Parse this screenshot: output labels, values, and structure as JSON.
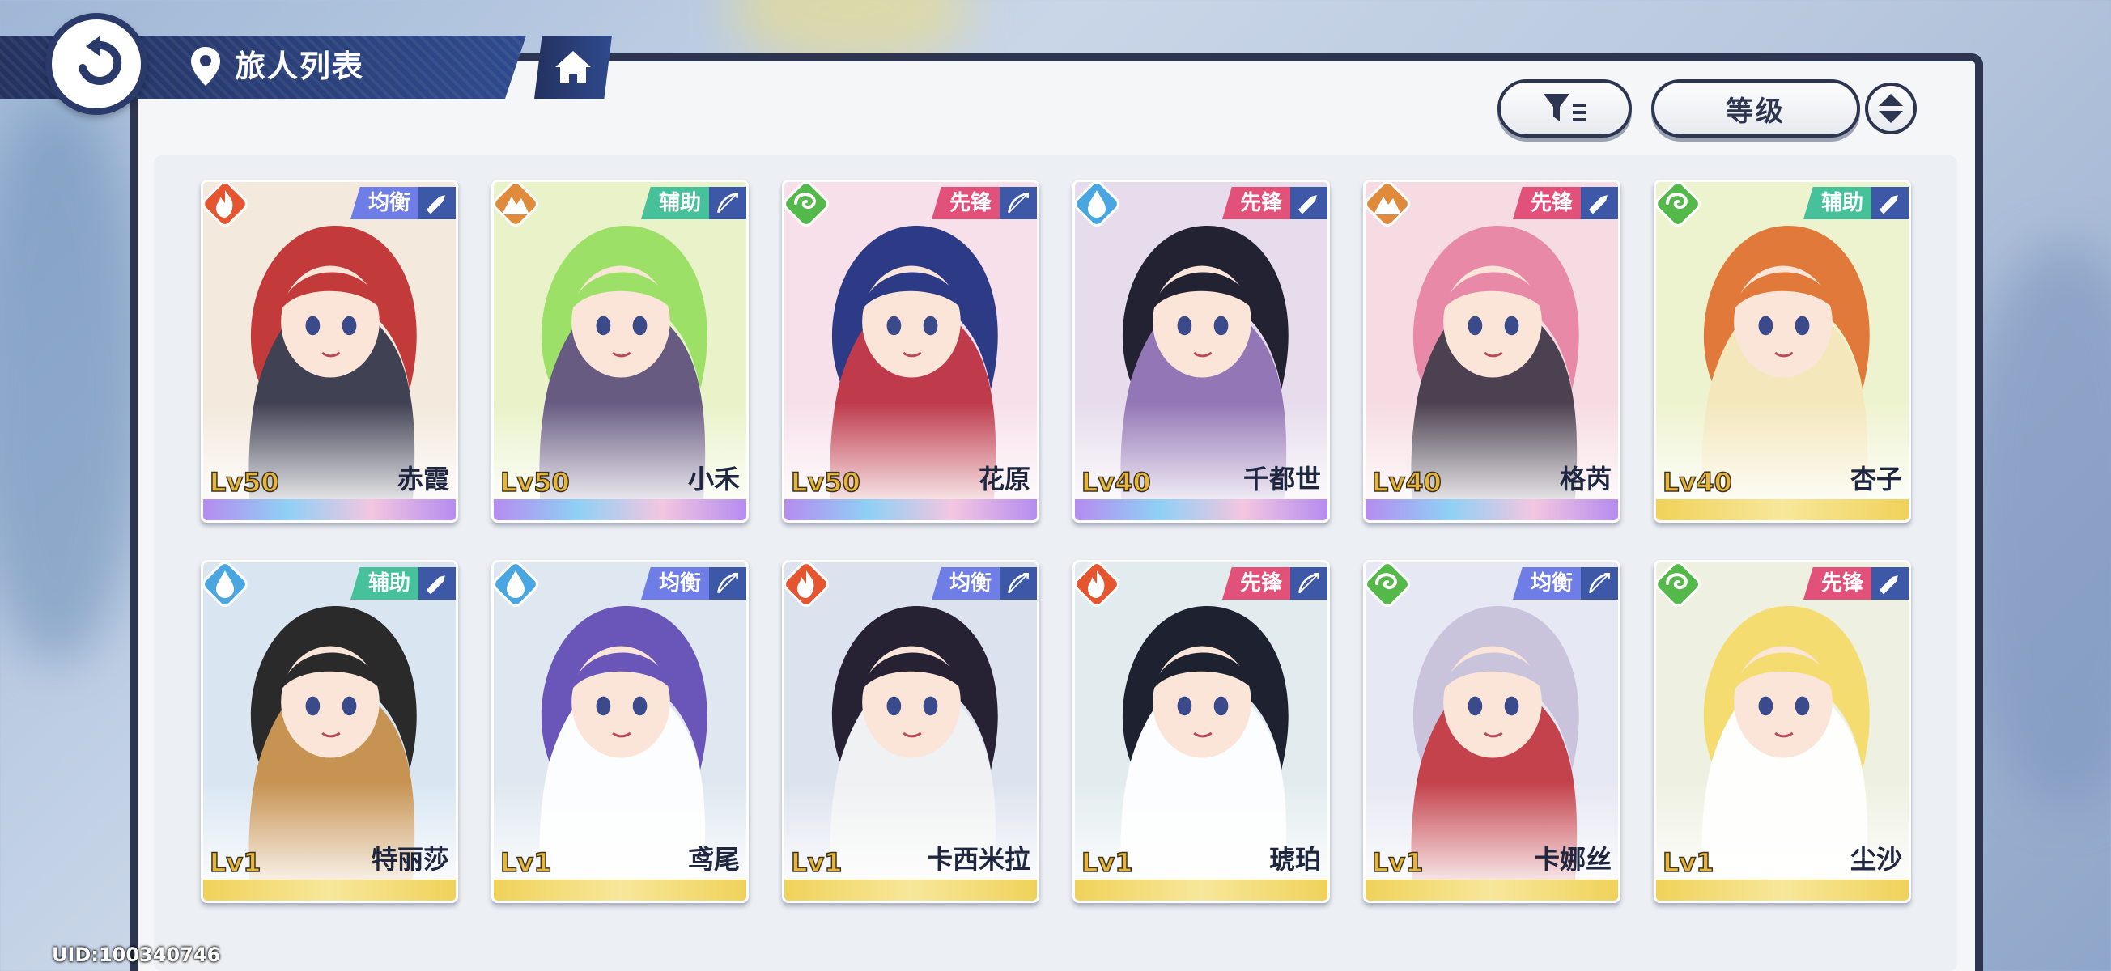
{
  "header": {
    "title": "旅人列表",
    "back_icon": "back-arrow-icon",
    "home_icon": "home-icon",
    "location_icon": "location-pin-icon"
  },
  "toolbar": {
    "filter_icon": "filter-icon",
    "sort_label": "等级",
    "order_icon": "sort-order-icon"
  },
  "colors": {
    "navy": "#2d3550",
    "role_balance": "#6f7de6",
    "role_support": "#46c19a",
    "role_vanguard": "#e2517a",
    "fire": "#e5552f",
    "earth": "#e08a3c",
    "wind": "#55b84a",
    "water": "#49a6e0"
  },
  "characters": [
    {
      "name": "赤霞",
      "level": "Lv50",
      "role": "均衡",
      "element": "fire",
      "weapon": "sword",
      "rarity": "rainbow"
    },
    {
      "name": "小禾",
      "level": "Lv50",
      "role": "辅助",
      "element": "earth",
      "weapon": "bow",
      "rarity": "rainbow"
    },
    {
      "name": "花原",
      "level": "Lv50",
      "role": "先锋",
      "element": "wind",
      "weapon": "bow",
      "rarity": "rainbow"
    },
    {
      "name": "千都世",
      "level": "Lv40",
      "role": "先锋",
      "element": "water",
      "weapon": "sword",
      "rarity": "rainbow"
    },
    {
      "name": "格芮",
      "level": "Lv40",
      "role": "先锋",
      "element": "earth",
      "weapon": "sword",
      "rarity": "rainbow"
    },
    {
      "name": "杏子",
      "level": "Lv40",
      "role": "辅助",
      "element": "wind",
      "weapon": "sword",
      "rarity": "gold"
    },
    {
      "name": "特丽莎",
      "level": "Lv1",
      "role": "辅助",
      "element": "water",
      "weapon": "sword",
      "rarity": "gold"
    },
    {
      "name": "鸢尾",
      "level": "Lv1",
      "role": "均衡",
      "element": "water",
      "weapon": "bow",
      "rarity": "gold"
    },
    {
      "name": "卡西米拉",
      "level": "Lv1",
      "role": "均衡",
      "element": "fire",
      "weapon": "bow",
      "rarity": "gold"
    },
    {
      "name": "琥珀",
      "level": "Lv1",
      "role": "先锋",
      "element": "fire",
      "weapon": "bow",
      "rarity": "gold"
    },
    {
      "name": "卡娜丝",
      "level": "Lv1",
      "role": "均衡",
      "element": "wind",
      "weapon": "bow",
      "rarity": "gold"
    },
    {
      "name": "尘沙",
      "level": "Lv1",
      "role": "先锋",
      "element": "wind",
      "weapon": "sword",
      "rarity": "gold"
    }
  ],
  "footer": {
    "uid": "UID:100340746"
  }
}
